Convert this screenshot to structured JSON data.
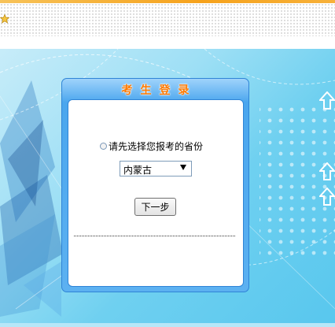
{
  "login": {
    "title": "考生登录",
    "prompt": "请先选择您报考的省份",
    "province_selected": "内蒙古",
    "next_button": "下一步"
  },
  "icons": [
    "star-icon",
    "radio-icon",
    "dropdown-arrow-icon",
    "arrow-up-icon"
  ],
  "colors": {
    "accent_orange": "#f6a21c",
    "panel_blue": "#4aa6ee",
    "title_orange": "#ff7a00",
    "background_cyan": "#6fd0f0"
  }
}
